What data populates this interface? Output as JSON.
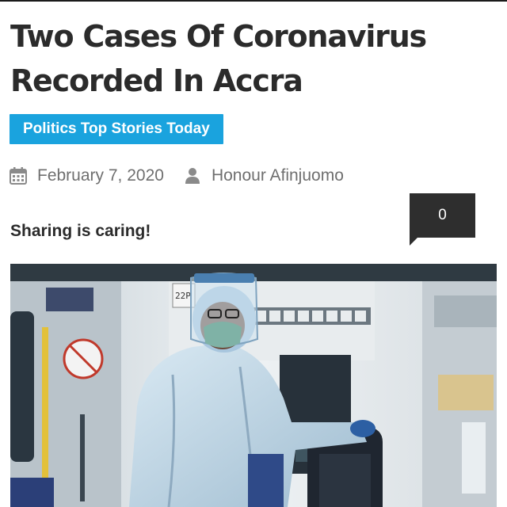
{
  "article": {
    "title": "Two Cases Of Coronavirus Recorded In Accra",
    "category": "Politics Top Stories Today",
    "date": "February 7, 2020",
    "author": "Honour Afinjuomo",
    "sharing_label": "Sharing is caring!",
    "share_count": "0"
  },
  "icons": {
    "date": "calendar-icon",
    "author": "user-icon"
  },
  "colors": {
    "category_bg": "#1aa3de",
    "title_text": "#2b2b2b",
    "meta_text": "#6f6f6f",
    "share_bg": "#2e2e2e"
  },
  "hero_image": {
    "caption_sign": "22P"
  }
}
